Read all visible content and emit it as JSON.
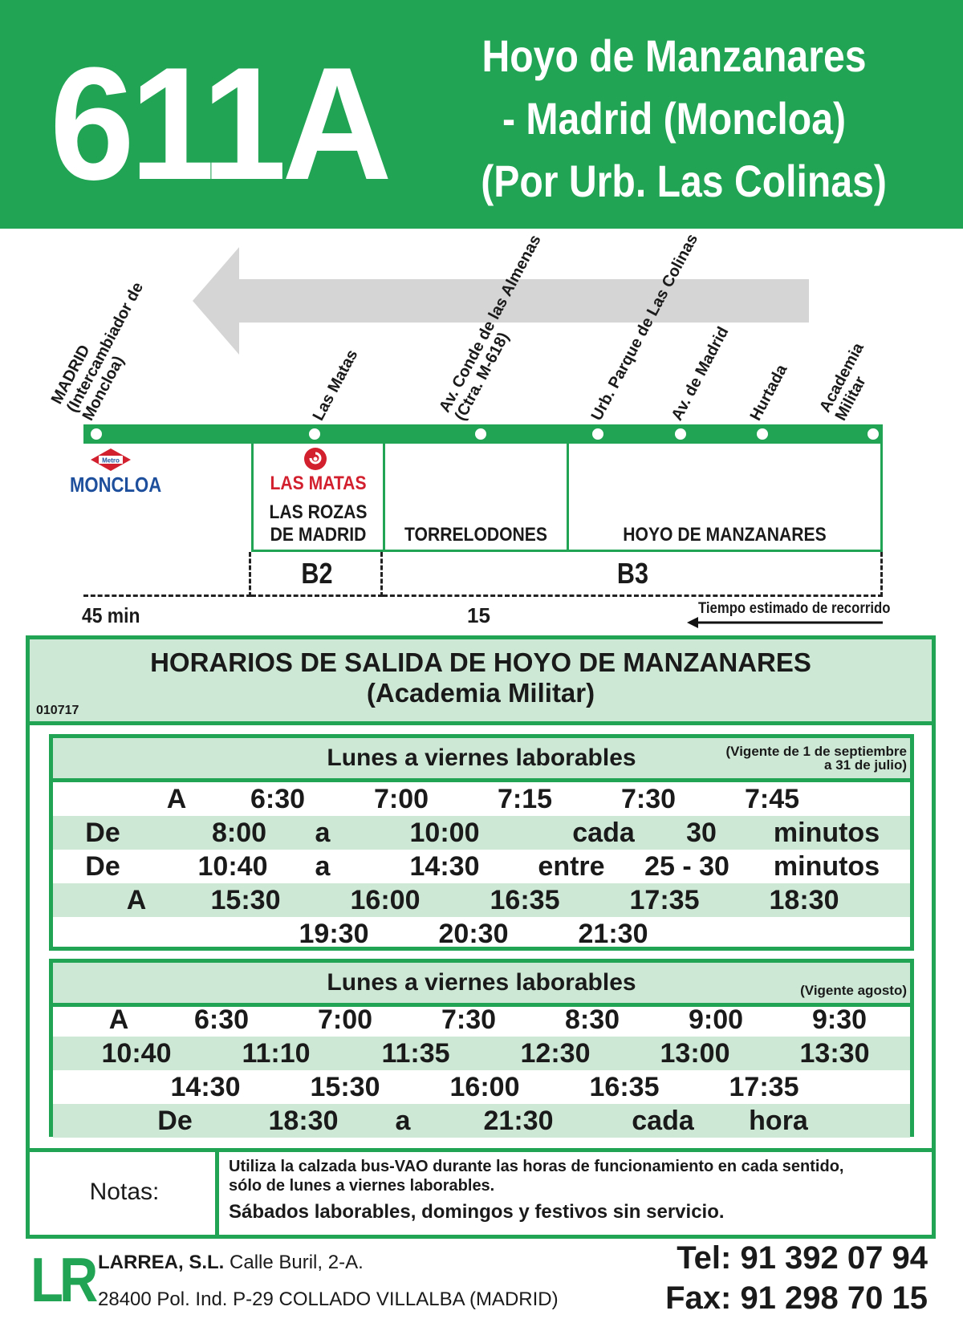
{
  "header": {
    "route": "611A",
    "title_line1": "Hoyo de Manzanares",
    "title_line2": "- Madrid (Moncloa)",
    "title_line3": "(Por Urb. Las Colinas)"
  },
  "colors": {
    "brand_green": "#22a455",
    "shade_green": "#cde9d6",
    "metro_red": "#d3202f",
    "metro_blue": "#1d4f9c",
    "cercanias_red": "#d3202f"
  },
  "stops": [
    {
      "line1": "MADRID",
      "line2": "(Intercambiador de",
      "line3": "Moncloa)"
    },
    {
      "line1": "Las Matas"
    },
    {
      "line1": "Av. Conde de las Almenas",
      "line2": "(Ctra. M-618)"
    },
    {
      "line1": "Urb. Parque de Las Colinas"
    },
    {
      "line1": "Av. de Madrid"
    },
    {
      "line1": "Hurtada"
    },
    {
      "line1": "Academia",
      "line2": "Militar"
    }
  ],
  "zones": {
    "moncloa_metro_badge": "Metro",
    "moncloa": "MONCLOA",
    "las_matas_station": "LAS MATAS",
    "las_rozas_l1": "LAS ROZAS",
    "las_rozas_l2": "DE MADRID",
    "torrelodones": "TORRELODONES",
    "hoyo": "HOYO DE MANZANARES",
    "fare_b2": "B2",
    "fare_b3": "B3"
  },
  "times": {
    "total": "45 min",
    "partial": "15",
    "legend": "Tiempo estimado de recorrido"
  },
  "schedule": {
    "title_l1": "HORARIOS DE SALIDA DE HOYO DE MANZANARES",
    "title_l2": "(Academia Militar)",
    "code": "010717",
    "table1": {
      "title": "Lunes a viernes laborables",
      "note_l1": "(Vigente de 1 de septiembre",
      "note_l2": "a 31 de julio)",
      "rows": [
        [
          "A",
          "6:30",
          "7:00",
          "7:15",
          "7:30",
          "7:45"
        ],
        [
          "De",
          "8:00",
          "a",
          "10:00",
          "cada",
          "30",
          "minutos"
        ],
        [
          "De",
          "10:40",
          "a",
          "14:30",
          "entre",
          "25 - 30",
          "minutos"
        ],
        [
          "A",
          "15:30",
          "16:00",
          "16:35",
          "17:35",
          "18:30"
        ],
        [
          "19:30",
          "20:30",
          "21:30"
        ]
      ]
    },
    "table2": {
      "title": "Lunes a viernes laborables",
      "note": "(Vigente agosto)",
      "rows": [
        [
          "A",
          "6:30",
          "7:00",
          "7:30",
          "8:30",
          "9:00",
          "9:30"
        ],
        [
          "10:40",
          "11:10",
          "11:35",
          "12:30",
          "13:00",
          "13:30"
        ],
        [
          "14:30",
          "15:30",
          "16:00",
          "16:35",
          "17:35"
        ],
        [
          "De",
          "18:30",
          "a",
          "21:30",
          "cada",
          "hora"
        ]
      ]
    },
    "notes_label": "Notas:",
    "note_l1": "Utiliza la calzada bus-VAO durante las horas de funcionamiento en cada sentido,",
    "note_l2": "sólo de lunes a viernes laborables.",
    "note_l3": "Sábados laborables, domingos y festivos sin servicio."
  },
  "footer": {
    "logo": "LR",
    "company": "LARREA, S.L.",
    "street": "Calle Buril, 2-A.",
    "city": "28400 Pol. Ind. P-29 COLLADO VILLALBA (MADRID)",
    "tel": "Tel: 91 392 07 94",
    "fax": "Fax: 91 298 70 15"
  }
}
